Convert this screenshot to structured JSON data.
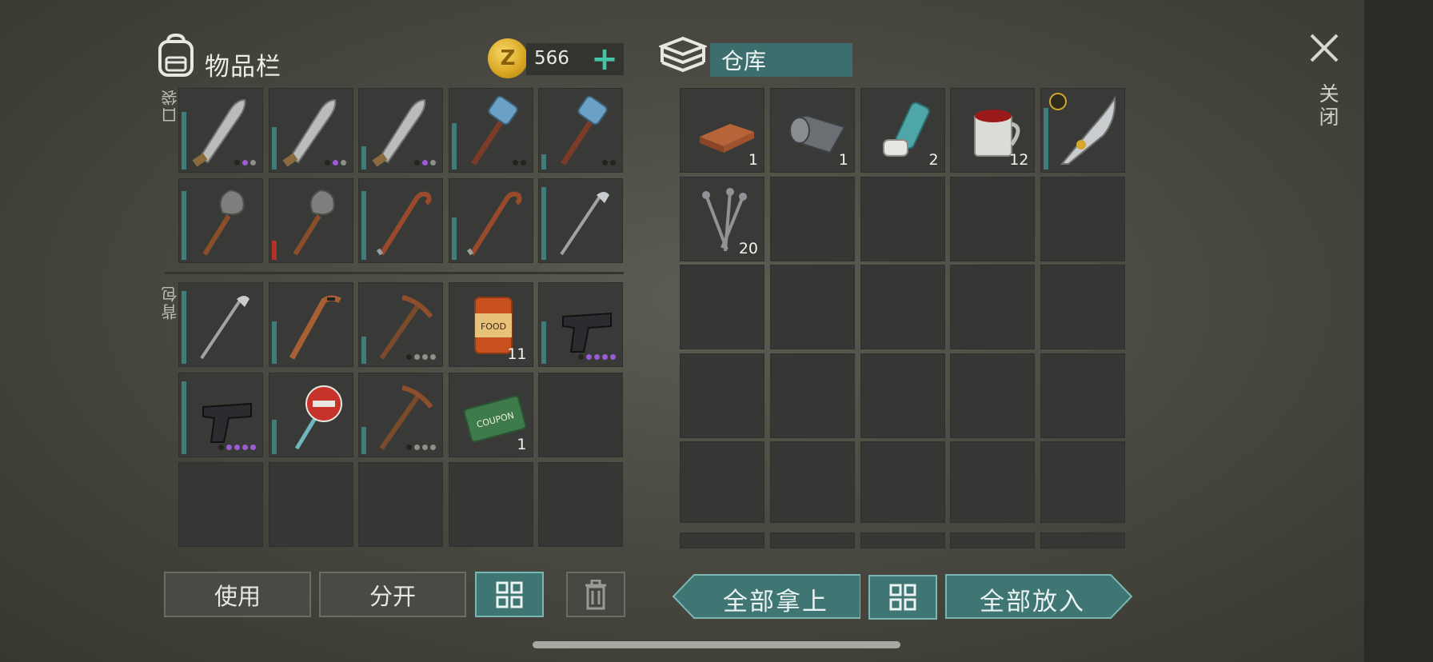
{
  "inventory": {
    "title": "物品栏",
    "coins": "566",
    "coin_symbol": "Z",
    "pocket_label": "口袋",
    "backpack_label": "背包",
    "pocket_slots": [
      {
        "name": "machete",
        "bar": 0.75,
        "dots": [
          "d",
          "p",
          "g"
        ]
      },
      {
        "name": "machete",
        "bar": 0.55,
        "dots": [
          "d",
          "p",
          "g"
        ]
      },
      {
        "name": "machete",
        "bar": 0.3,
        "dots": [
          "d",
          "p",
          "g"
        ]
      },
      {
        "name": "sledgehammer",
        "bar": 0.6,
        "dots": [
          "d",
          "d"
        ]
      },
      {
        "name": "sledgehammer",
        "bar": 0.2,
        "dots": [
          "d",
          "d"
        ]
      },
      {
        "name": "shovel",
        "bar": 0.9
      },
      {
        "name": "shovel",
        "bar": 0.25,
        "red": true
      },
      {
        "name": "crowbar",
        "bar": 0.9
      },
      {
        "name": "crowbar",
        "bar": 0.55
      },
      {
        "name": "golf-club",
        "bar": 0.95
      }
    ],
    "backpack_slots": [
      {
        "name": "golf-club",
        "bar": 0.95
      },
      {
        "name": "hockey-stick",
        "bar": 0.55
      },
      {
        "name": "pickaxe",
        "bar": 0.35,
        "dots": [
          "d",
          "g",
          "g",
          "g"
        ]
      },
      {
        "name": "canned-food",
        "qty": "11"
      },
      {
        "name": "pistol",
        "bar": 0.55,
        "dots": [
          "d",
          "p",
          "p",
          "p",
          "p"
        ]
      },
      {
        "name": "pistol",
        "bar": 0.95,
        "dots": [
          "d",
          "p",
          "p",
          "p",
          "p"
        ]
      },
      {
        "name": "stop-sign",
        "bar": 0.45
      },
      {
        "name": "pickaxe",
        "bar": 0.35,
        "dots": [
          "d",
          "g",
          "g",
          "g"
        ]
      },
      {
        "name": "ration-coupon",
        "qty": "1"
      },
      {
        "name": "empty"
      },
      {
        "name": "empty"
      },
      {
        "name": "empty"
      },
      {
        "name": "empty"
      },
      {
        "name": "empty"
      },
      {
        "name": "empty"
      }
    ],
    "buttons": {
      "use": "使用",
      "split": "分开"
    }
  },
  "storage": {
    "title": "仓库",
    "slots": [
      {
        "name": "copper-ingot",
        "qty": "1"
      },
      {
        "name": "tarp-roll",
        "qty": "1"
      },
      {
        "name": "inhaler",
        "qty": "2"
      },
      {
        "name": "mug",
        "qty": "12"
      },
      {
        "name": "ornate-blade",
        "bar": 0.8
      },
      {
        "name": "nails",
        "qty": "20"
      }
    ],
    "buttons": {
      "take_all": "全部拿上",
      "put_all": "全部放入"
    }
  },
  "close_label": "关闭",
  "colors": {
    "accent": "#3f7573",
    "bar": "#3e7d79",
    "rare": "#9b5bd8",
    "gold": "#d4a72c"
  }
}
